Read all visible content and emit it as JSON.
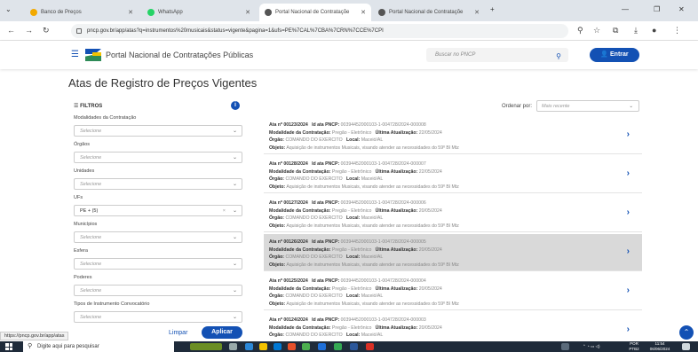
{
  "tabs": [
    {
      "label": "Banco de Preços",
      "color": "#f2a900"
    },
    {
      "label": "WhatsApp",
      "color": "#25d366"
    },
    {
      "label": "Portal Nacional de Contrataçõe",
      "color": "#555555"
    },
    {
      "label": "Portal Nacional de Contrataçõe",
      "color": "#555555"
    }
  ],
  "address": {
    "url": "pncp.gov.br/app/atas?q=instrumentos%20musicais&status=vigente&pagina=1&ufs=PE%7CAL%7CBA%7CRN%7CCE%7CPI"
  },
  "header": {
    "brand": "Portal Nacional de Contratações Públicas",
    "search_placeholder": "Buscar no PNCP",
    "login_label": "Entrar"
  },
  "page_title": "Atas de Registro de Preços Vigentes",
  "filters": {
    "heading": "FILTROS",
    "items": [
      {
        "label": "Modalidades da Contratação",
        "value": "Selecione"
      },
      {
        "label": "Órgãos",
        "value": "Selecione"
      },
      {
        "label": "Unidades",
        "value": "Selecione"
      },
      {
        "label": "UFs",
        "value": "PE + (5)"
      },
      {
        "label": "Municípios",
        "value": "Selecione"
      },
      {
        "label": "Esfera",
        "value": "Selecione"
      },
      {
        "label": "Poderes",
        "value": "Selecione"
      },
      {
        "label": "Tipos de Instrumento Convocatório",
        "value": "Selecione"
      }
    ],
    "clear_label": "Limpar",
    "apply_label": "Aplicar"
  },
  "sort": {
    "label": "Ordenar por:",
    "value": "Mais recente"
  },
  "field_labels": {
    "ata": "Ata nº",
    "id_pncp": "Id ata PNCP:",
    "modalidade": "Modalidade da Contratação:",
    "atualizacao": "Última Atualização:",
    "orgao": "Órgão:",
    "local": "Local:",
    "objeto": "Objeto:"
  },
  "results": [
    {
      "ata": "00123/2024",
      "id": "00394452000103-1-004728/2024-000008",
      "modalidade": "Pregão - Eletrônico",
      "atualizacao": "22/05/2024",
      "orgao": "COMANDO DO EXERCITO",
      "local": "Maceió/AL",
      "objeto": "Aquisição de instrumentos Musicais, visando atender as necessidades do 59º Bl Mtz",
      "highlight": false
    },
    {
      "ata": "00128/2024",
      "id": "00394452000103-1-004728/2024-000007",
      "modalidade": "Pregão - Eletrônico",
      "atualizacao": "22/05/2024",
      "orgao": "COMANDO DO EXERCITO",
      "local": "Maceió/AL",
      "objeto": "Aquisição de instrumentos Musicais, visando atender as necessidades do 59º Bl Mtz",
      "highlight": false
    },
    {
      "ata": "00127/2024",
      "id": "00394452000103-1-004728/2024-000006",
      "modalidade": "Pregão - Eletrônico",
      "atualizacao": "20/05/2024",
      "orgao": "COMANDO DO EXERCITO",
      "local": "Maceió/AL",
      "objeto": "Aquisição de instrumentos Musicais, visando atender as necessidades do 59º Bl Mtz",
      "highlight": false
    },
    {
      "ata": "00126/2024",
      "id": "00394452000103-1-004728/2024-000005",
      "modalidade": "Pregão - Eletrônico",
      "atualizacao": "20/05/2024",
      "orgao": "COMANDO DO EXERCITO",
      "local": "Maceió/AL",
      "objeto": "Aquisição de instrumentos Musicais, visando atender as necessidades do 59º Bl Mtz",
      "highlight": true
    },
    {
      "ata": "00125/2024",
      "id": "00394452000103-1-004728/2024-000004",
      "modalidade": "Pregão - Eletrônico",
      "atualizacao": "20/05/2024",
      "orgao": "COMANDO DO EXERCITO",
      "local": "Maceió/AL",
      "objeto": "Aquisição de instrumentos Musicais, visando atender as necessidades do 59º Bl Mtz",
      "highlight": false
    },
    {
      "ata": "00124/2024",
      "id": "00394452000103-1-004728/2024-000003",
      "modalidade": "Pregão - Eletrônico",
      "atualizacao": "20/05/2024",
      "orgao": "COMANDO DO EXERCITO",
      "local": "Maceió/AL",
      "objeto": "",
      "highlight": false
    }
  ],
  "status_url": "https://pncp.gov.br/app/atas",
  "taskbar": {
    "search_placeholder": "Digite aqui para pesquisar",
    "lang": "POR PTB2",
    "time": "11:54",
    "date": "06/06/2024"
  }
}
